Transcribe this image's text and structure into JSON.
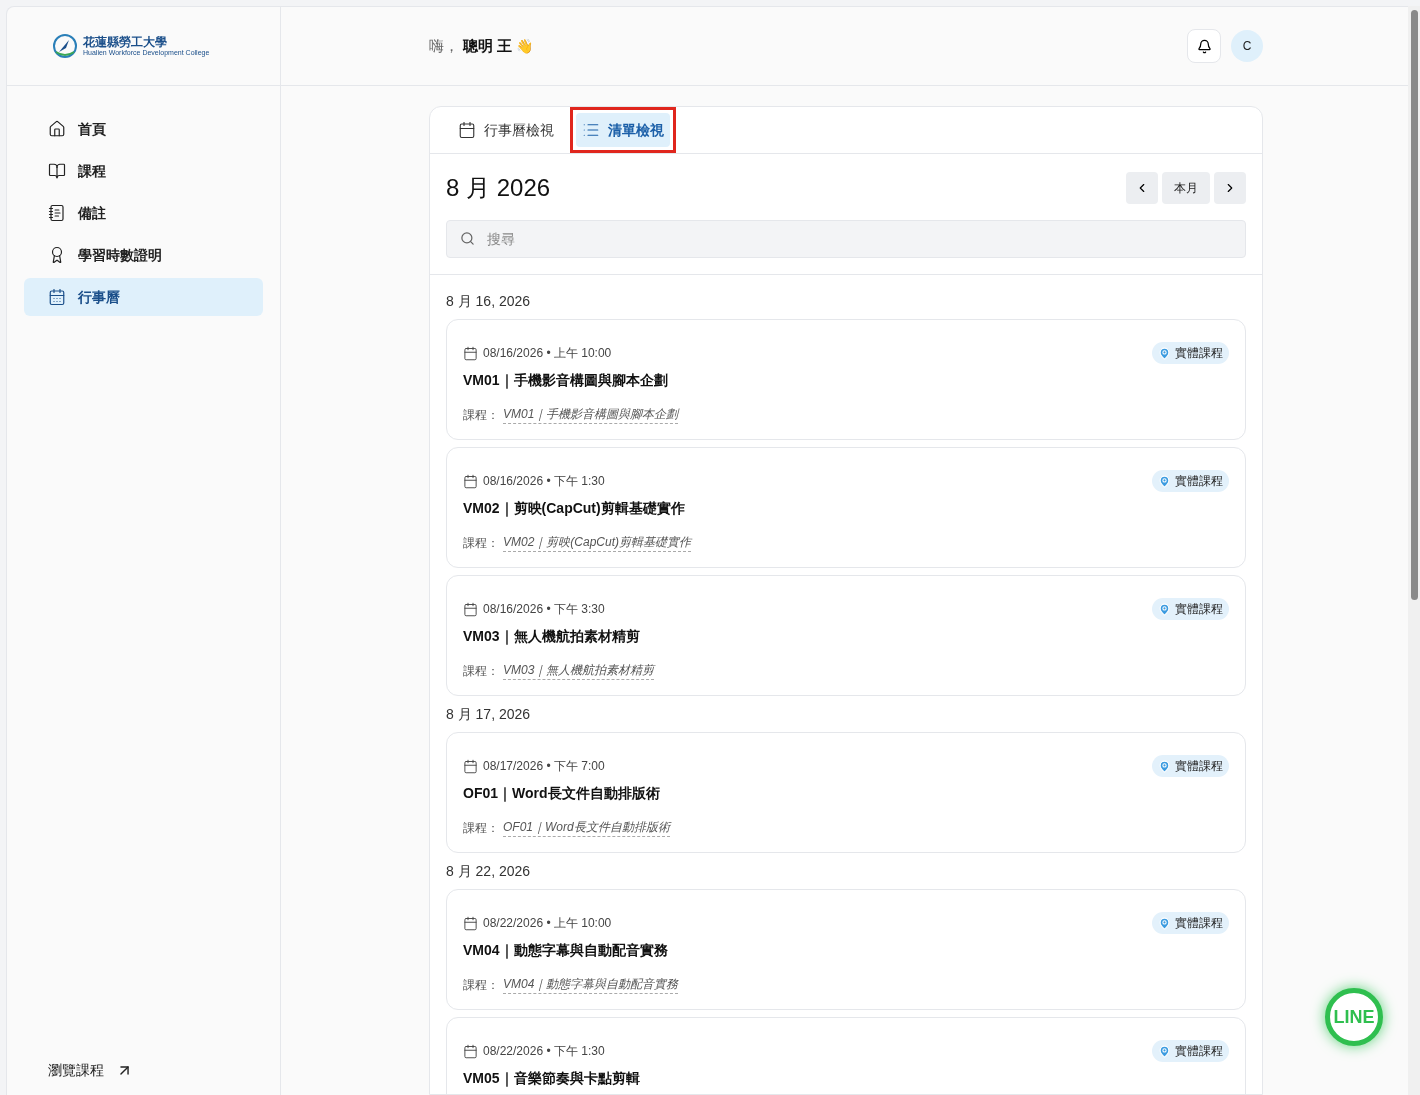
{
  "logo": {
    "name": "花蓮縣勞工大學",
    "subtitle": "Hualien Workforce Development College"
  },
  "sidebar": {
    "items": [
      {
        "label": "首頁",
        "selected": false
      },
      {
        "label": "課程",
        "selected": false
      },
      {
        "label": "備註",
        "selected": false
      },
      {
        "label": "學習時數證明",
        "selected": false
      },
      {
        "label": "行事曆",
        "selected": true
      }
    ],
    "footer_link": "瀏覽課程"
  },
  "header": {
    "greeting": "嗨，",
    "user_name": "聰明 王",
    "wave": "👋",
    "avatar": "C"
  },
  "tabs": [
    {
      "label": "行事曆檢視",
      "selected": false,
      "highlighted": false
    },
    {
      "label": "清單檢視",
      "selected": true,
      "highlighted": true
    }
  ],
  "month_title": "8 月 2026",
  "nav": {
    "today": "本月"
  },
  "search": {
    "placeholder": "搜尋"
  },
  "groups": [
    {
      "date": "8 月 16, 2026",
      "events": [
        {
          "datetime": "08/16/2026 • 上午 10:00",
          "title": "VM01｜手機影音構圖與腳本企劃",
          "course_label": "課程：",
          "course": "VM01｜手機影音構圖與腳本企劃",
          "tag": "實體課程"
        },
        {
          "datetime": "08/16/2026 • 下午 1:30",
          "title": "VM02｜剪映(CapCut)剪輯基礎實作",
          "course_label": "課程：",
          "course": "VM02｜剪映(CapCut)剪輯基礎實作",
          "tag": "實體課程"
        },
        {
          "datetime": "08/16/2026 • 下午 3:30",
          "title": "VM03｜無人機航拍素材精剪",
          "course_label": "課程：",
          "course": "VM03｜無人機航拍素材精剪",
          "tag": "實體課程"
        }
      ]
    },
    {
      "date": "8 月 17, 2026",
      "events": [
        {
          "datetime": "08/17/2026 • 下午 7:00",
          "title": "OF01｜Word長文件自動排版術",
          "course_label": "課程：",
          "course": "OF01｜Word長文件自動排版術",
          "tag": "實體課程"
        }
      ]
    },
    {
      "date": "8 月 22, 2026",
      "events": [
        {
          "datetime": "08/22/2026 • 上午 10:00",
          "title": "VM04｜動態字幕與自動配音實務",
          "course_label": "課程：",
          "course": "VM04｜動態字幕與自動配音實務",
          "tag": "實體課程"
        },
        {
          "datetime": "08/22/2026 • 下午 1:30",
          "title": "VM05｜音樂節奏與卡點剪輯",
          "tag": "實體課程"
        }
      ]
    }
  ],
  "line_button": "LINE"
}
